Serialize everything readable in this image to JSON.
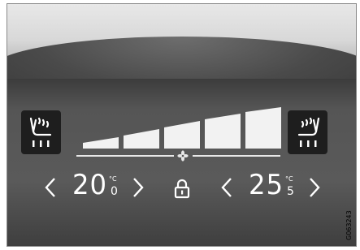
{
  "climate_panel": {
    "left_zone": {
      "temperature_whole": "20",
      "temperature_decimal": "0",
      "unit": "°C",
      "decrease_label": "<",
      "increase_label": ">"
    },
    "right_zone": {
      "temperature_whole": "25",
      "temperature_decimal": "5",
      "unit": "°C",
      "decrease_label": "<",
      "increase_label": ">"
    },
    "fan_level": 5,
    "fan_level_max": 5,
    "icons": {
      "left_seat": "heated-seat-icon",
      "right_seat": "heated-seat-icon",
      "fan": "fan-icon",
      "lock": "lock-icon"
    },
    "colors": {
      "display_text": "#ffffff",
      "panel_background": "#555555",
      "seat_button_background": "#1e1e1e"
    }
  },
  "catalog_code": "G063243"
}
